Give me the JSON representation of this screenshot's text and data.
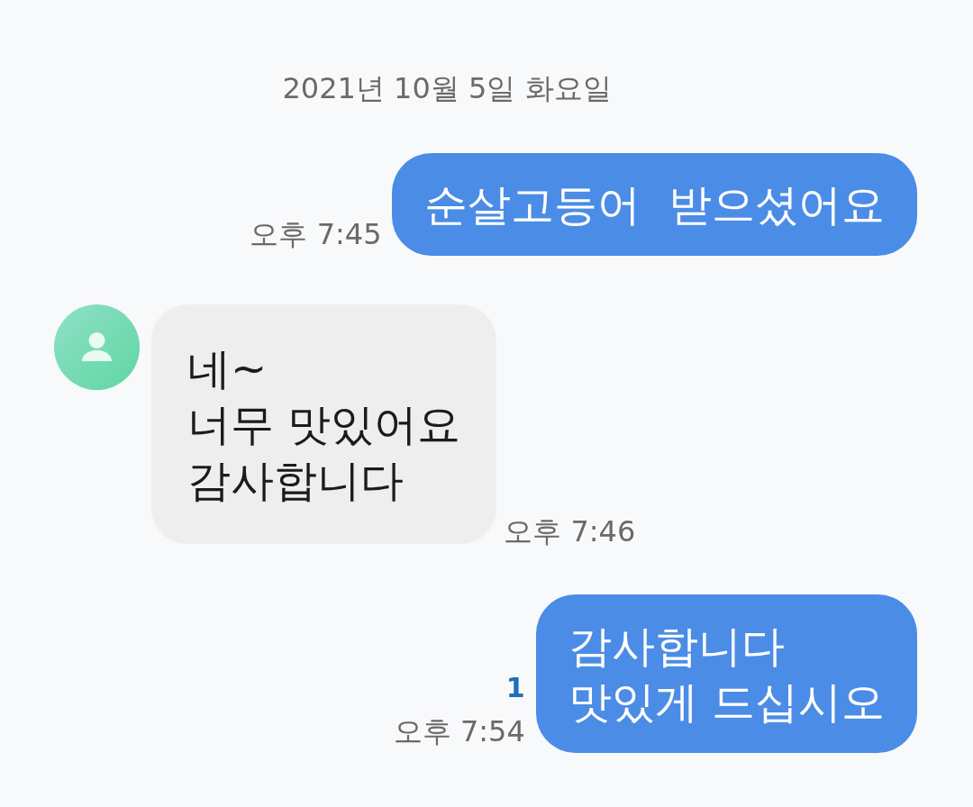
{
  "date": "2021년 10월 5일 화요일",
  "messages": [
    {
      "kind": "sent",
      "lines": [
        "순살고등어  받으셨어요"
      ],
      "time": "오후 7:45"
    },
    {
      "kind": "received",
      "lines": [
        "네~",
        "너무 맛있어요",
        "감사합니다"
      ],
      "time": "오후 7:46"
    },
    {
      "kind": "sent",
      "lines": [
        "감사합니다",
        "맛있게 드십시오"
      ],
      "time": "오후 7:54",
      "unread": "1"
    }
  ]
}
